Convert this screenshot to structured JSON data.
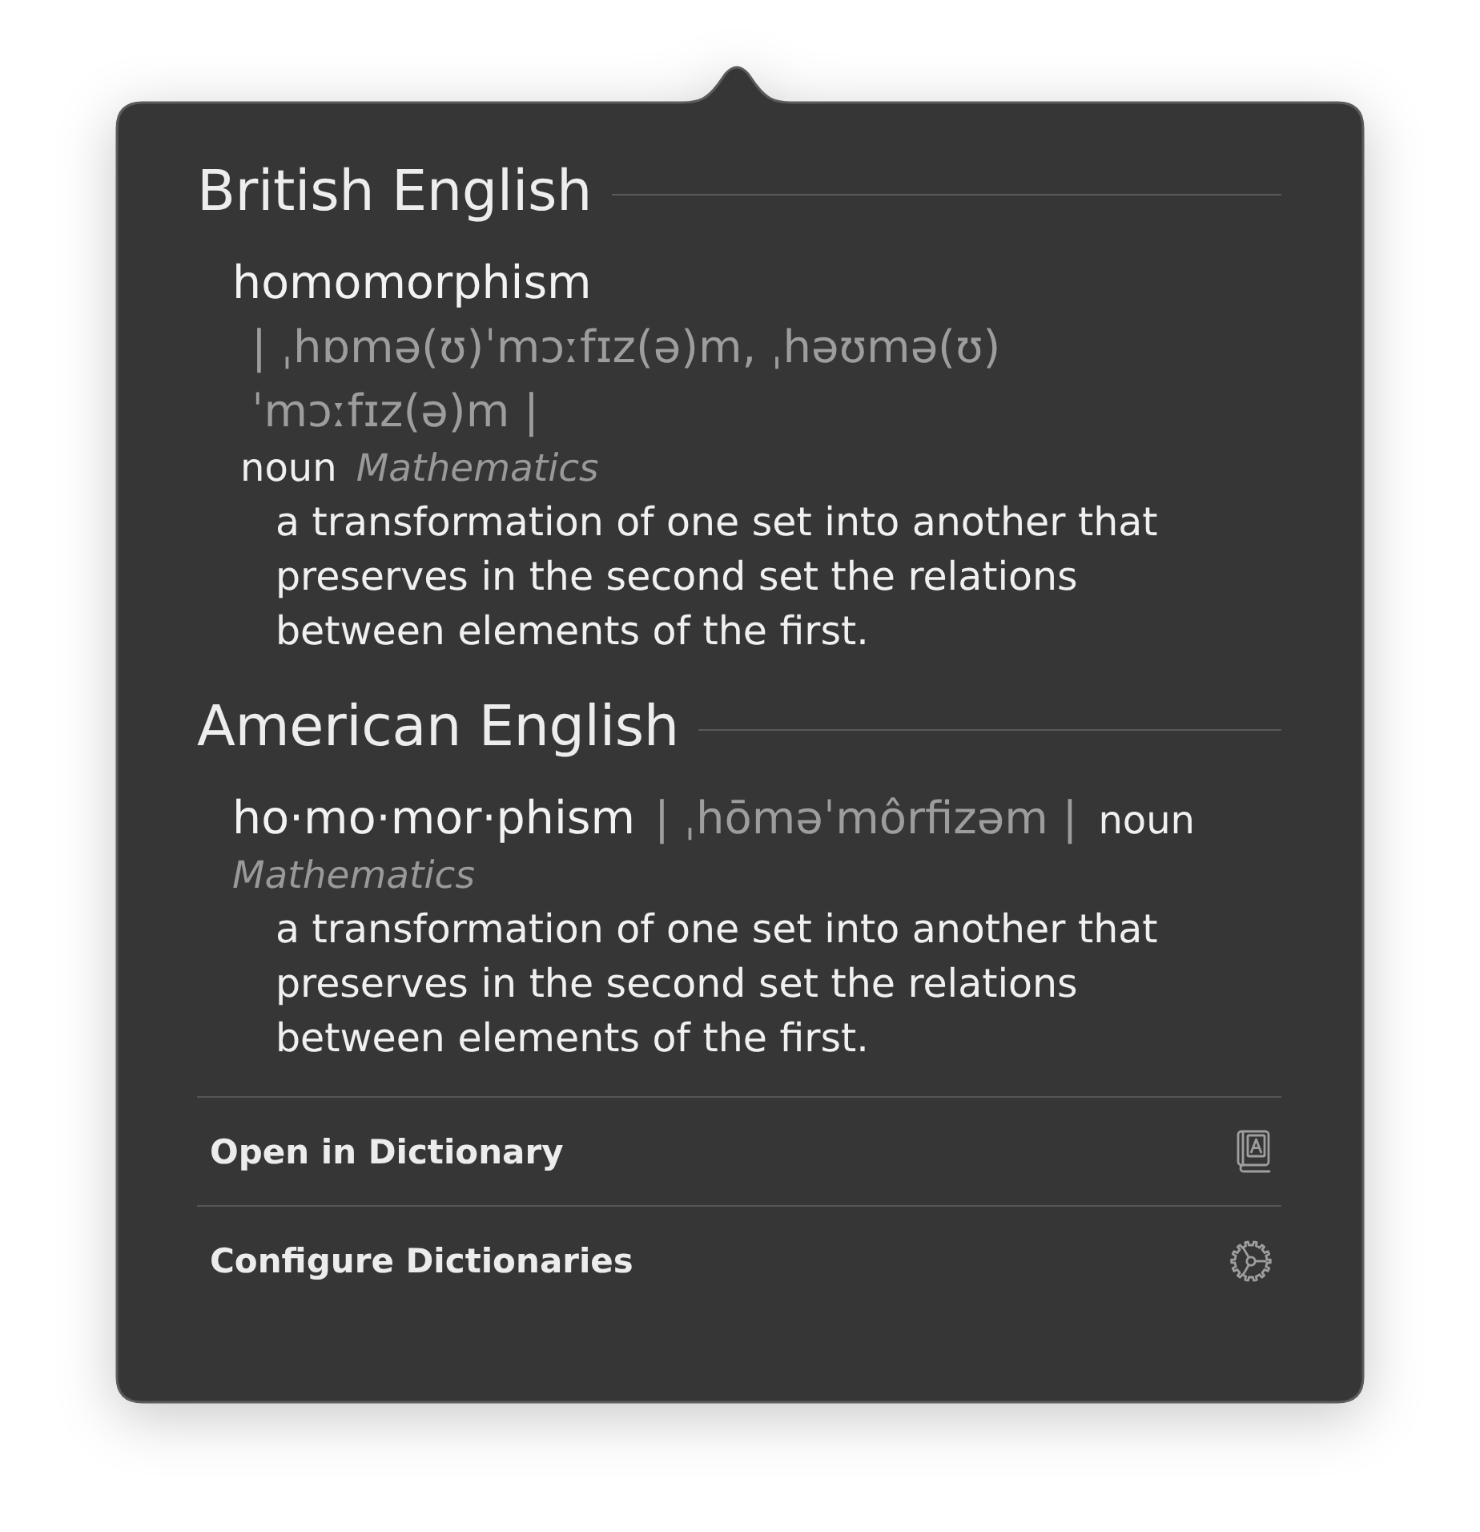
{
  "popover": {
    "sections": [
      {
        "heading": "British English",
        "entry": {
          "headword": "homomorphism",
          "pronunciation": "| ˌhɒmə(ʊ)ˈmɔːfɪz(ə)m, ˌhəʊmə(ʊ)ˈmɔːfɪz(ə)m |",
          "part_of_speech": "noun",
          "domain": "Mathematics",
          "definition": "a transformation of one set into another that preserves in the second set the relations between elements of the first."
        }
      },
      {
        "heading": "American English",
        "entry": {
          "headword": "ho·mo·mor·phism",
          "pronunciation": "| ˌhōməˈmôrfizəm |",
          "part_of_speech": "noun",
          "domain": "Mathematics",
          "definition": "a transformation of one set into another that preserves in the second set the relations between elements of the first."
        }
      }
    ],
    "actions": [
      {
        "label": "Open in Dictionary",
        "kind": "book"
      },
      {
        "label": "Configure Dictionaries",
        "kind": "gear"
      }
    ]
  }
}
